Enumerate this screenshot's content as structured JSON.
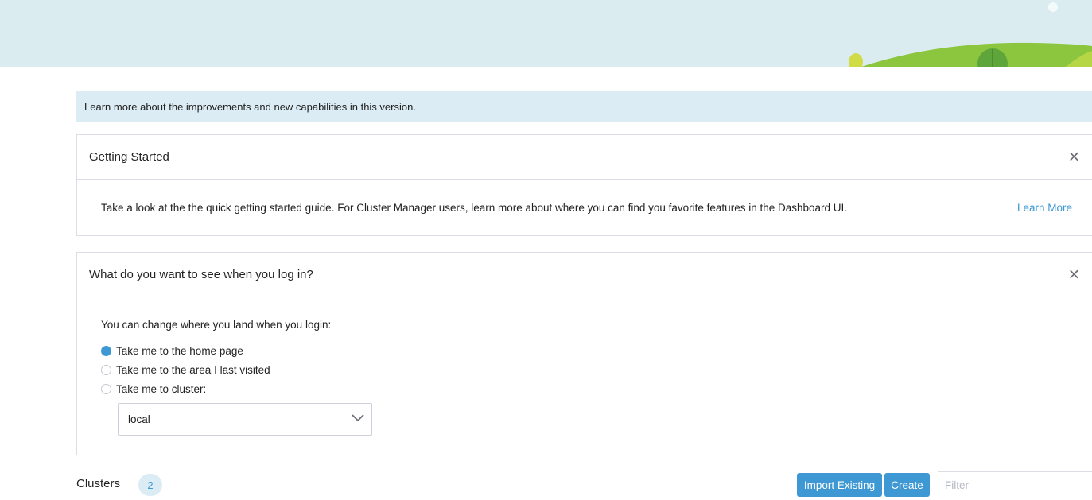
{
  "banner": {
    "sky_color": "#dbecf0",
    "hill_color": "#8cc63f"
  },
  "info_bar": {
    "text": "Learn more about the improvements and new capabilities in this version."
  },
  "getting_started": {
    "title": "Getting Started",
    "body": "Take a look at the the quick getting started guide. For Cluster Manager users, learn more about where you can find you favorite features in the Dashboard UI.",
    "link": "Learn More"
  },
  "login_pref": {
    "title": "What do you want to see when you log in?",
    "prompt": "You can change where you land when you login:",
    "options": [
      {
        "label": "Take me to the home page",
        "checked": true
      },
      {
        "label": "Take me to the area I last visited",
        "checked": false
      },
      {
        "label": "Take me to cluster:",
        "checked": false
      }
    ],
    "cluster_select_value": "local"
  },
  "clusters": {
    "title": "Clusters",
    "count": "2",
    "import_label": "Import Existing",
    "create_label": "Create",
    "filter_placeholder": "Filter"
  },
  "colors": {
    "accent": "#3d98d3",
    "info_bg": "#dbecf4",
    "border": "#dcdee7"
  },
  "icons": {
    "close": "close-icon",
    "dropdown": "chevron-down-icon"
  }
}
